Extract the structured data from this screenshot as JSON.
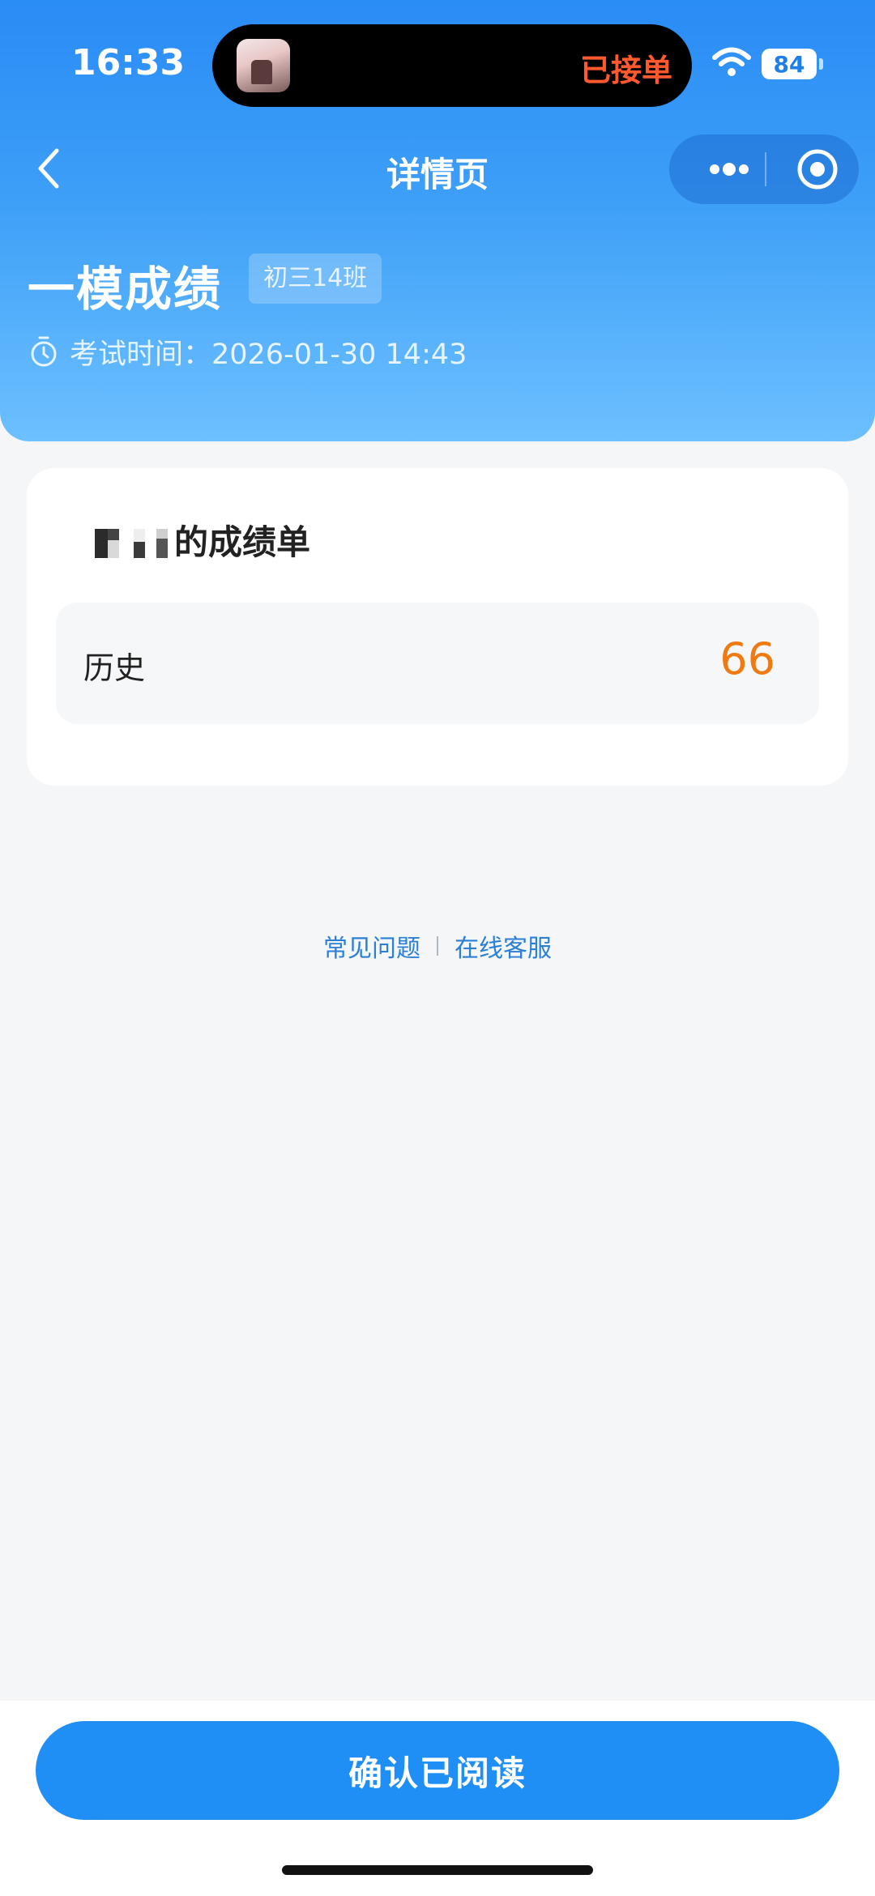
{
  "status_bar": {
    "time": "16:33",
    "island_text": "已接单",
    "battery": "84"
  },
  "nav": {
    "title": "详情页"
  },
  "exam": {
    "title": "一模成绩",
    "class_tag": "初三14班",
    "time_label": "考试时间：2026-01-30 14:43"
  },
  "card": {
    "sheet_title": "的成绩单",
    "subjects": [
      {
        "name": "历史",
        "score": "66"
      }
    ]
  },
  "links": {
    "faq": "常见问题",
    "support": "在线客服"
  },
  "footer": {
    "confirm_label": "确认已阅读"
  },
  "colors": {
    "primary": "#1f8ef5",
    "score": "#f07a12",
    "island_text": "#ff5a2e",
    "link": "#2b7fd6"
  }
}
